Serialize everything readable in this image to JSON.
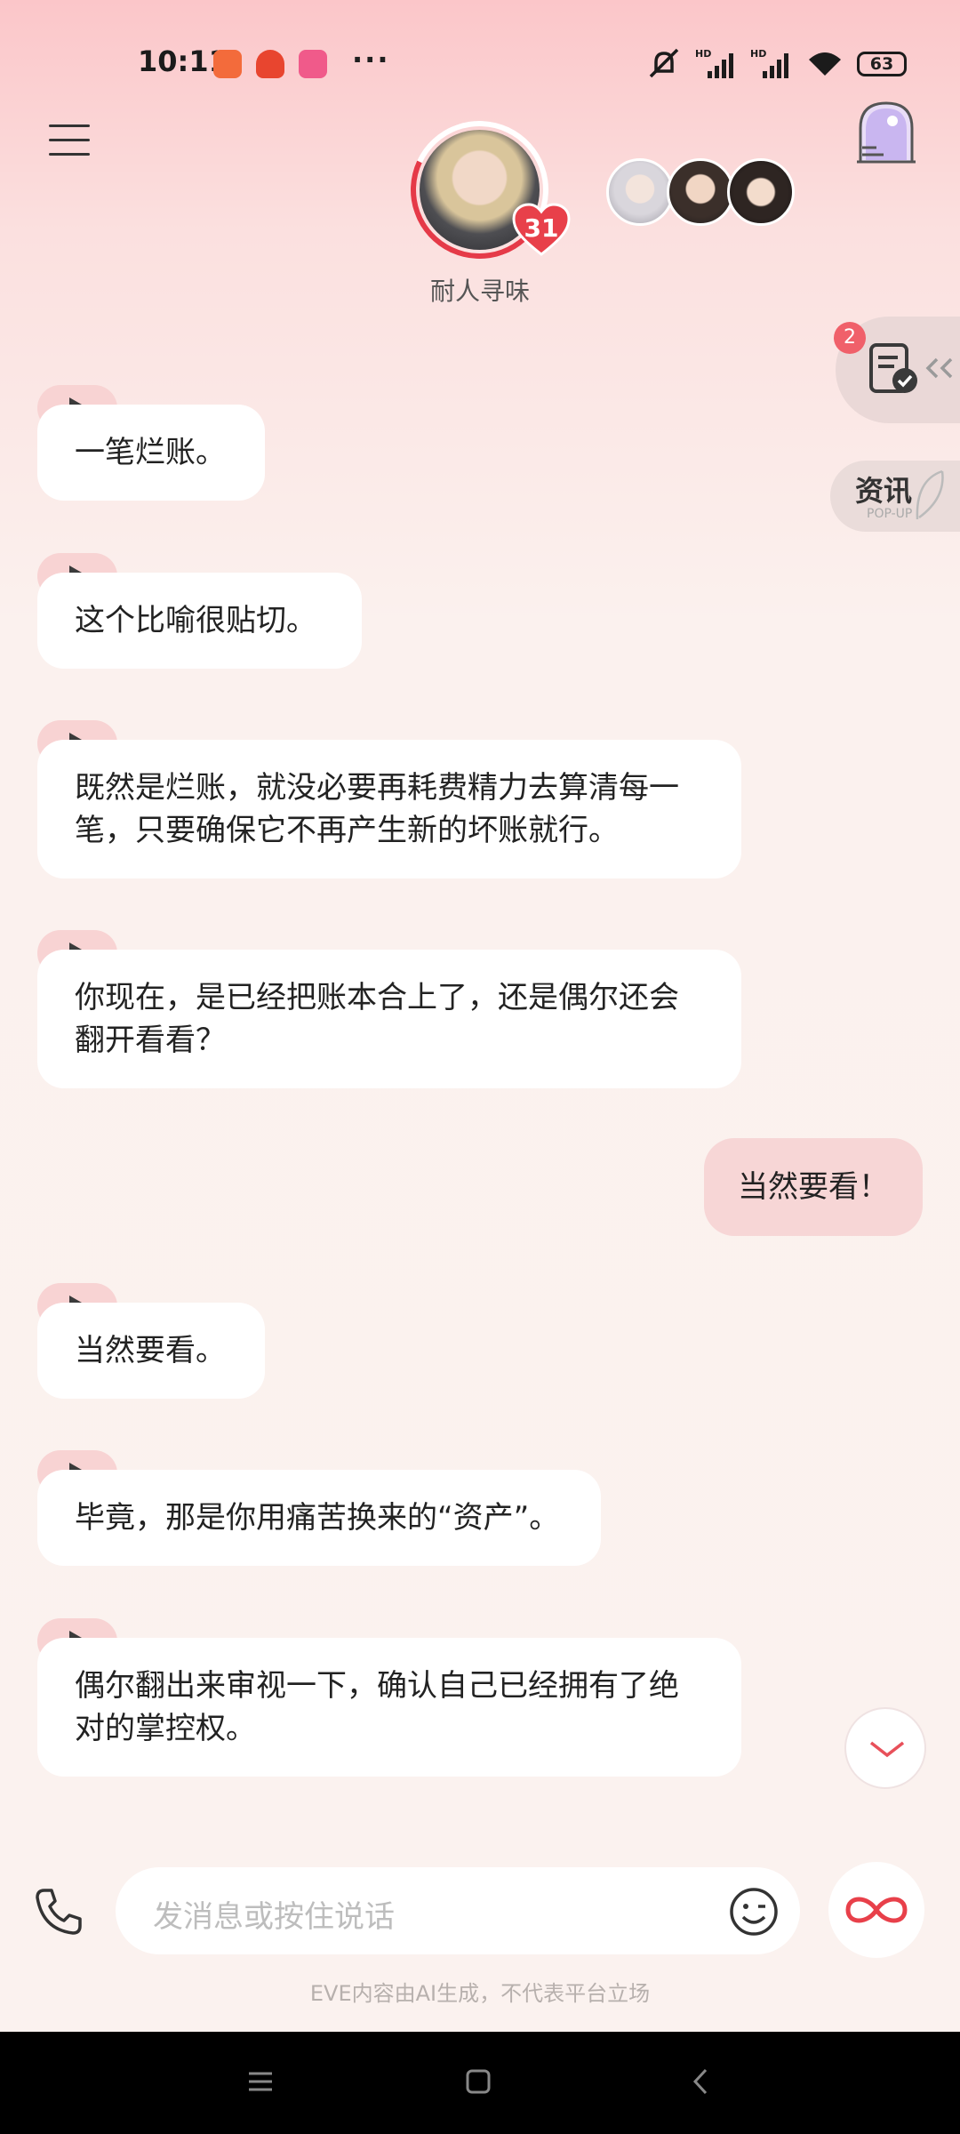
{
  "status_bar": {
    "time": "10:11",
    "more": "···",
    "battery": "63",
    "icons": [
      "app-orange-icon",
      "app-red-icon",
      "app-pink-icon",
      "mute-icon",
      "hd-signal-icon",
      "hd-signal-icon",
      "wifi-icon",
      "battery-icon"
    ]
  },
  "header": {
    "character_name": "耐人寻味",
    "level_badge": "31",
    "menu_icon": "menu-icon",
    "portal_icon": "portal-icon"
  },
  "side": {
    "task_badge": "2",
    "news_label": "资讯",
    "news_sub": "POP-UP"
  },
  "messages": [
    {
      "role": "ai",
      "text": "一笔烂账。"
    },
    {
      "role": "ai",
      "text": "这个比喻很贴切。"
    },
    {
      "role": "ai",
      "text": "既然是烂账，就没必要再耗费精力去算清每一笔，只要确保它不再产生新的坏账就行。"
    },
    {
      "role": "ai",
      "text": "你现在，是已经把账本合上了，还是偶尔还会翻开看看？"
    },
    {
      "role": "user",
      "text": "当然要看！"
    },
    {
      "role": "ai",
      "text": "当然要看。"
    },
    {
      "role": "ai",
      "text": "毕竟，那是你用痛苦换来的“资产”。"
    },
    {
      "role": "ai",
      "text": "偶尔翻出来审视一下，确认自己已经拥有了绝对的掌控权。"
    }
  ],
  "input": {
    "placeholder": "发消息或按住说话"
  },
  "disclaimer": "EVE内容由AI生成，不代表平台立场",
  "colors": {
    "accent": "#e53a48",
    "user_bubble": "#f7d6d6",
    "play_tab": "#f8d3d3"
  }
}
